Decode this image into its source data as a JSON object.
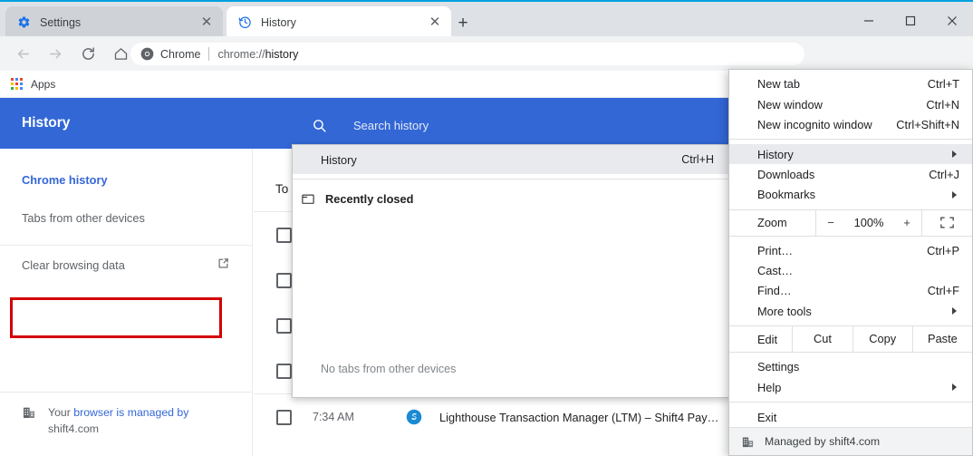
{
  "window": {
    "minimize": "—",
    "maximize": "☐",
    "close": "✕"
  },
  "tabs": [
    {
      "title": "Settings",
      "favicon": "gear-icon",
      "active": false,
      "close": "✕"
    },
    {
      "title": "History",
      "favicon": "history-clock-icon",
      "active": true,
      "close": "✕"
    }
  ],
  "new_tab_label": "+",
  "toolbar": {
    "back": "←",
    "forward": "→",
    "reload": "⟳",
    "home": "⌂",
    "security_label": "Chrome",
    "url_prefix": "chrome://",
    "url_main": "history",
    "star": "☆",
    "extensions": [
      "green-drop-icon",
      "e-circle-icon",
      "g-circle-icon"
    ],
    "avatar": "profile-avatar",
    "overflow": "three-dot-menu"
  },
  "bookmarks": {
    "apps_label": "Apps"
  },
  "history_page": {
    "header_title": "History",
    "search_placeholder": "Search history",
    "sidebar": [
      {
        "label": "Chrome history",
        "active": true
      },
      {
        "label": "Tabs from other devices",
        "active": false
      },
      {
        "label": "Clear browsing data",
        "active": false,
        "external": true,
        "highlighted": true
      }
    ],
    "managed_prefix": "Your ",
    "managed_link": "browser is managed by",
    "managed_suffix": " shift4.com",
    "day_label": "To",
    "entries": [
      {
        "time": "",
        "title": ""
      },
      {
        "time": "",
        "title": ""
      },
      {
        "time": "",
        "title": ""
      },
      {
        "time": "",
        "title": ""
      },
      {
        "time": "7:34 AM",
        "title": "Lighthouse Transaction Manager (LTM) – Shift4 Pay…"
      }
    ]
  },
  "history_submenu": {
    "title_item": {
      "label": "History",
      "accel": "Ctrl+H"
    },
    "recently_closed": {
      "label": "Recently closed",
      "icon": "window-icon"
    },
    "empty_message": "No tabs from other devices"
  },
  "chrome_menu": {
    "items": [
      {
        "label": "New tab",
        "accel": "Ctrl+T"
      },
      {
        "label": "New window",
        "accel": "Ctrl+N"
      },
      {
        "label": "New incognito window",
        "accel": "Ctrl+Shift+N"
      },
      {
        "label": "History",
        "submenu": true,
        "highlighted": true
      },
      {
        "label": "Downloads",
        "accel": "Ctrl+J"
      },
      {
        "label": "Bookmarks",
        "submenu": true
      },
      {
        "label": "Print…",
        "accel": "Ctrl+P"
      },
      {
        "label": "Cast…",
        "accel": ""
      },
      {
        "label": "Find…",
        "accel": "Ctrl+F"
      },
      {
        "label": "More tools",
        "submenu": true
      },
      {
        "label": "Settings",
        "accel": ""
      },
      {
        "label": "Help",
        "submenu": true
      },
      {
        "label": "Exit",
        "accel": ""
      }
    ],
    "zoom": {
      "label": "Zoom",
      "minus": "−",
      "value": "100%",
      "plus": "+",
      "fullscreen": "fullscreen-icon"
    },
    "edit": {
      "label": "Edit",
      "cut": "Cut",
      "copy": "Copy",
      "paste": "Paste"
    },
    "managed_footer": {
      "label": "Managed by shift4.com",
      "icon": "enterprise-building-icon"
    }
  },
  "colors": {
    "accent_blue": "#3367d6",
    "titlebar_top": "#00a0e0",
    "highlight_red": "#d40000",
    "tabbar_bg": "#dee1e6",
    "toolbar_bg": "#f1f3f4"
  }
}
